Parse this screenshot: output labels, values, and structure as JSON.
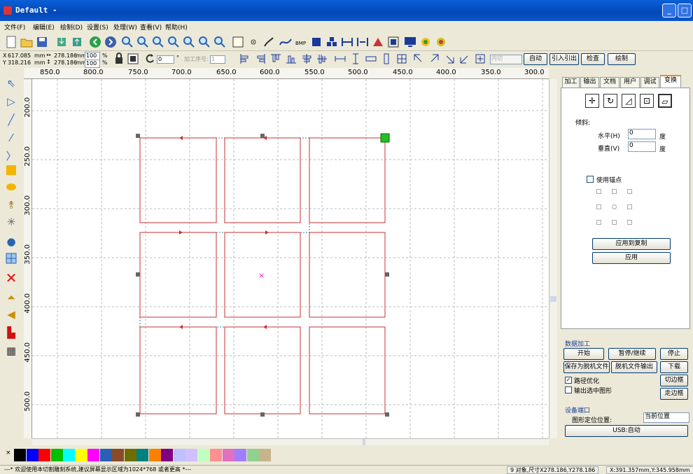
{
  "window": {
    "title": "Default -",
    "min": "_",
    "max": "□",
    "close": "×"
  },
  "menu": [
    "文件(F)",
    "编辑(E)",
    "绘制(D)",
    "设置(S)",
    "处理(W)",
    "查看(V)",
    "帮助(H)"
  ],
  "coords": {
    "x": "617.085",
    "x_unit": "mm",
    "y": "318.216",
    "y_unit": "mm",
    "w": "278.186",
    "w_unit": "mm",
    "h": "278.186",
    "h_unit": "mm",
    "sx": "100",
    "sy": "100",
    "percent": "%",
    "angle": "0",
    "degree": "°",
    "order_label": "加工序号:",
    "order_value": "1",
    "cut_select": "内切"
  },
  "toolbar2_buttons": {
    "auto": "自动",
    "lead": "引入引出",
    "check": "检查",
    "draw": "绘制"
  },
  "ruler_labels": [
    "850.0",
    "800.0",
    "750.0",
    "700.0",
    "650.0",
    "600.0",
    "550.0",
    "500.0",
    "450.0",
    "400.0",
    "350.0",
    "300.0"
  ],
  "vruler_labels": [
    "200.0",
    "250.0",
    "300.0",
    "350.0",
    "400.0",
    "450.0",
    "500.0"
  ],
  "tabs": [
    "加工",
    "输出",
    "文档",
    "用户",
    "调试",
    "变换"
  ],
  "transform": {
    "skew_label": "倾斜:",
    "h_label": "水平(H)",
    "h_value": "0",
    "h_unit": "度",
    "v_label": "垂直(V)",
    "v_value": "0",
    "v_unit": "度",
    "anchor_label": "使用锚点",
    "apply_copy": "应用到复制",
    "apply": "应用"
  },
  "data_proc": {
    "title": "数据加工",
    "start": "开始",
    "pause": "暂停/继续",
    "stop": "停止",
    "save_offline": "保存为脱机文件",
    "offline_out": "脱机文件输出",
    "download": "下载",
    "path_opt": "路径优化",
    "path_opt_checked": true,
    "output_selected": "输出选中图形",
    "output_selected_checked": false,
    "cut_frame": "切边框",
    "walk_frame": "走边框"
  },
  "device": {
    "title": "设备端口",
    "pos_label": "图形定位位置:",
    "pos_value": "当前位置",
    "usb": "USB:自动"
  },
  "palette": [
    "#000000",
    "#0000ff",
    "#ff0000",
    "#00c000",
    "#00ffff",
    "#ffff00",
    "#ff00ff",
    "#2a5fb5",
    "#8a4b2a",
    "#6e6e00",
    "#008080",
    "#ff8000",
    "#800080",
    "#c0c0ff",
    "#d0c0ff",
    "#c0ffc0",
    "#ff9090",
    "#e070c0",
    "#9f7fff",
    "#90d090",
    "#c8b48c"
  ],
  "status": {
    "message": "---* 欢迎使用本切割雕刻系统,建议屏幕显示区域为1024*768 或者更高 *---",
    "objects": "9 对象,尺寸X278.186,Y278.186",
    "cursor": "X:391.357mm,Y:345.958mm"
  },
  "colors": {
    "accent": "#0a5fd8",
    "cut_line": "#c83232",
    "dash_line": "#2b7fb3",
    "center": "#d020d0"
  }
}
